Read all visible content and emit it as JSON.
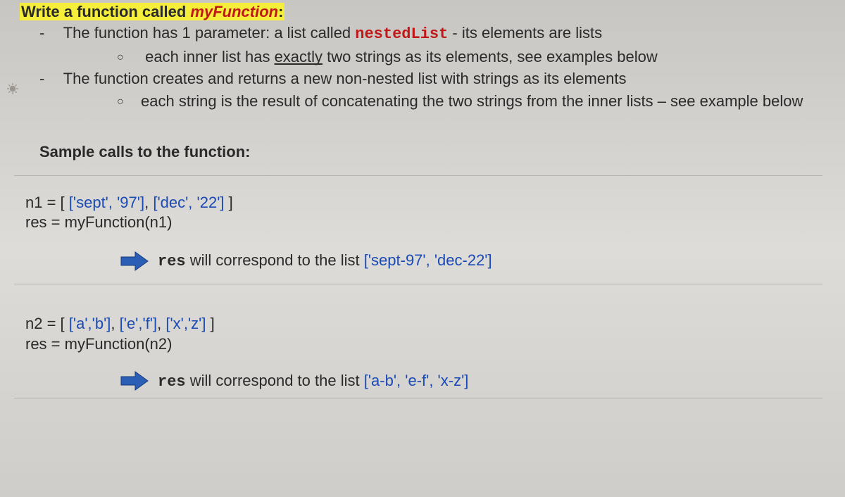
{
  "title": {
    "prefix": "Write a function called ",
    "fn": "myFunction",
    "suffix": ":"
  },
  "bullets": {
    "b1_prefix": "The function has 1 parameter: a list called ",
    "b1_code": "nestedList",
    "b1_suffix": " - its elements are lists",
    "b1a_prefix": "each inner list has ",
    "b1a_underlined": "exactly",
    "b1a_suffix": " two strings as its elements, see examples below",
    "b2": "The function creates and returns a new non-nested list with strings as its elements",
    "b2a": "each string is the result of concatenating the two strings from the inner lists – see example below"
  },
  "sample_heading": "Sample calls to the function:",
  "ex1": {
    "line1_pre": "n1 = [ ",
    "line1_p1": "['sept', '97']",
    "line1_mid1": ", ",
    "line1_p2": "['dec', '22']",
    "line1_post": " ]",
    "line2": "res = myFunction(n1)",
    "res_label_code": "res",
    "res_label_text": " will correspond to the list  ",
    "res_value": "['sept-97', 'dec-22']"
  },
  "ex2": {
    "line1_pre": "n2 = [ ",
    "line1_p1": "['a','b']",
    "line1_mid1": ", ",
    "line1_p2": "['e','f']",
    "line1_mid2": ", ",
    "line1_p3": "['x','z']",
    "line1_post": " ]",
    "line2": "res = myFunction(n2)",
    "res_label_code": "res",
    "res_label_text": " will correspond to the list  ",
    "res_value": "['a-b', 'e-f', 'x-z']"
  }
}
